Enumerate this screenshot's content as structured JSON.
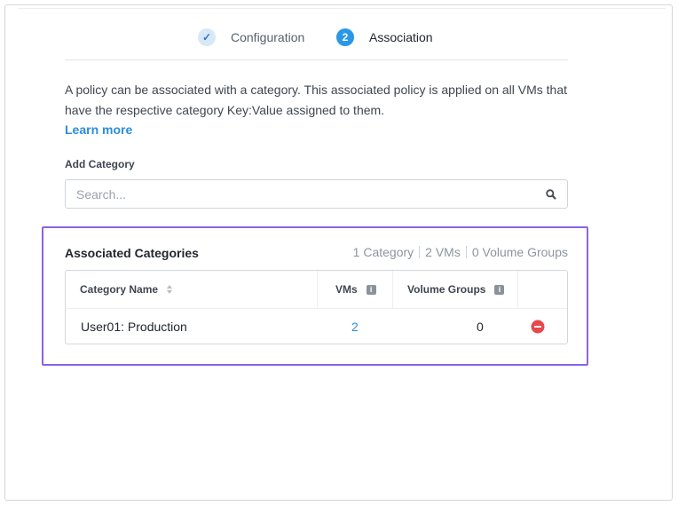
{
  "wizard": {
    "steps": [
      {
        "marker": "✓",
        "label": "Configuration",
        "state": "done"
      },
      {
        "marker": "2",
        "label": "Association",
        "state": "active"
      }
    ]
  },
  "description": "A policy can be associated with a category. This associated policy is applied on all VMs that have the respective category Key:Value assigned to them.",
  "learn_more": "Learn more",
  "add_category": {
    "label": "Add Category",
    "placeholder": "Search..."
  },
  "associated": {
    "title": "Associated Categories",
    "counts": [
      "1 Category",
      "2 VMs",
      "0 Volume Groups"
    ],
    "columns": {
      "category_name": "Category Name",
      "vms": "VMs",
      "volume_groups": "Volume Groups"
    },
    "rows": [
      {
        "category": "User01: Production",
        "vms": "2",
        "volume_groups": "0"
      }
    ]
  },
  "colors": {
    "accent": "#2a97e8",
    "link": "#2a8ddf",
    "highlight_border": "#8a63e6",
    "remove": "#e5484d"
  }
}
